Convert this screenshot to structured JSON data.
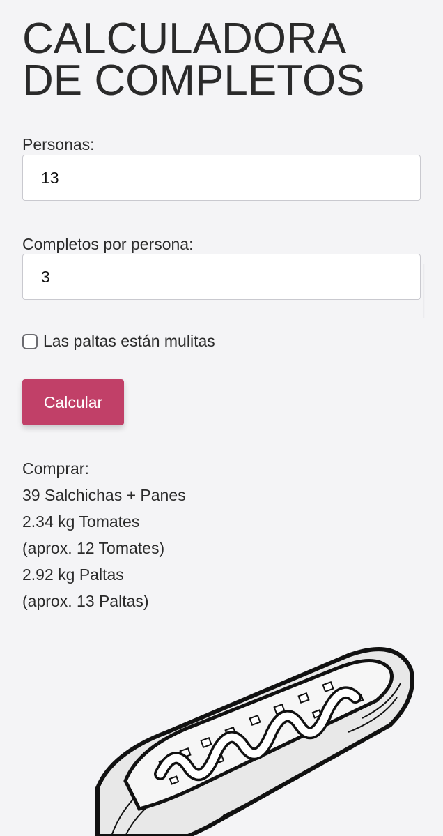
{
  "title": {
    "line1": "CALCULADORA",
    "line2": "DE COMPLETOS"
  },
  "form": {
    "personas_label": "Personas:",
    "personas_value": "13",
    "completos_label": "Completos por persona:",
    "completos_value": "3",
    "checkbox_label": "Las paltas están mulitas",
    "checkbox_checked": false,
    "calculate_label": "Calcular"
  },
  "results": {
    "heading": "Comprar:",
    "lines": [
      "39 Salchichas + Panes",
      "2.34 kg Tomates",
      "(aprox. 12 Tomates)",
      "2.92 kg Paltas",
      "(aprox. 13 Paltas)"
    ]
  },
  "colors": {
    "background": "#f4f4f6",
    "button": "#c14068",
    "text": "#2b2b2b"
  },
  "icons": {
    "illustration": "hotdog-illustration"
  }
}
